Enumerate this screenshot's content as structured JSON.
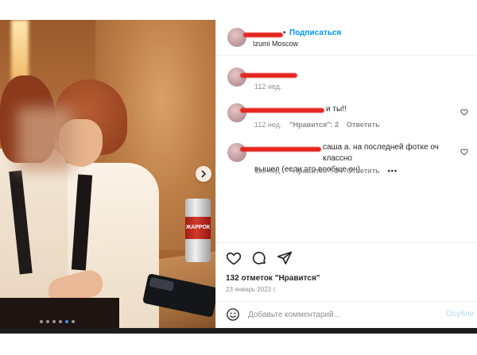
{
  "post": {
    "photo": {
      "can_label": "ЖАРРОК",
      "carousel": {
        "slide_count": 6,
        "active_index": 4
      }
    },
    "header": {
      "follow_label": "Подписаться",
      "separator": "•",
      "location": "Izumi Moscow"
    },
    "comments": [
      {
        "text": "",
        "time": "112 нед.",
        "likes": "",
        "reply": ""
      },
      {
        "text": "и ты!!",
        "time": "112 нед.",
        "likes": "\"Нравится\": 2",
        "reply": "Ответить"
      },
      {
        "text_line1": "саша а. на последней фотке оч классно",
        "text_line2": "вышел (если это вообще он)",
        "time": "112 нед.",
        "likes": "\"Нравится\": 2",
        "reply": "Ответить",
        "more": "•••"
      }
    ],
    "likes": "132 отметок \"Нравится\"",
    "date": "23 январь 2023 г.",
    "comment_box": {
      "placeholder": "Добавьте комментарий...",
      "post_label": "Опубли"
    },
    "icons": {
      "like": "heart-icon",
      "comment": "comment-icon",
      "share": "share-icon",
      "emoji": "emoji-icon",
      "next": "chevron-right-icon"
    },
    "colors": {
      "accent": "#0095f6",
      "redaction": "#e4261f",
      "muted": "#8e8e8e"
    }
  }
}
